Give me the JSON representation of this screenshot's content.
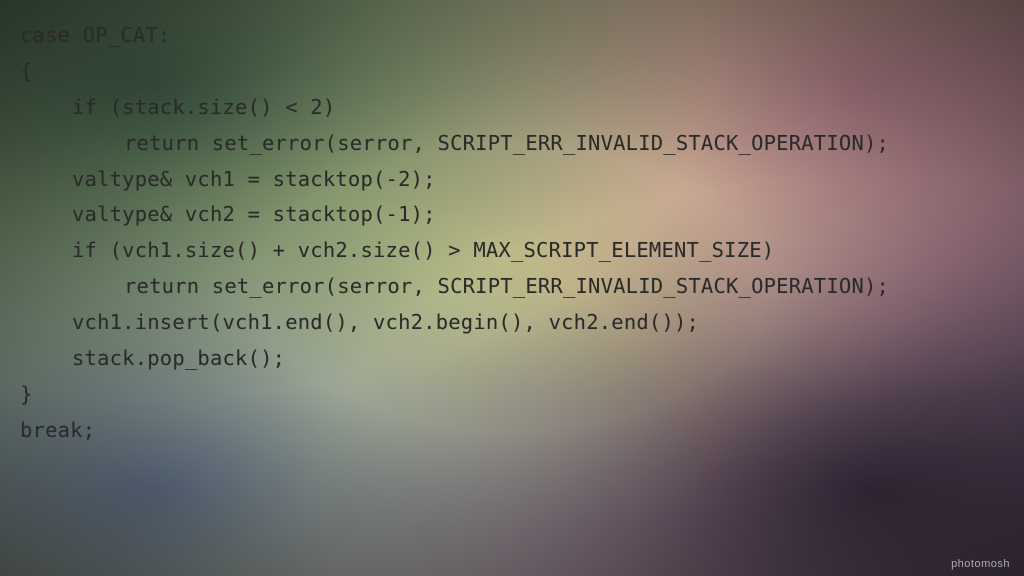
{
  "code": {
    "lines": [
      {
        "text": "case OP_CAT:",
        "indent": 0
      },
      {
        "text": "{",
        "indent": 0
      },
      {
        "text": "if (stack.size() < 2)",
        "indent": 1
      },
      {
        "text": "return set_error(serror, SCRIPT_ERR_INVALID_STACK_OPERATION);",
        "indent": 2
      },
      {
        "text": "valtype& vch1 = stacktop(-2);",
        "indent": 1
      },
      {
        "text": "valtype& vch2 = stacktop(-1);",
        "indent": 1
      },
      {
        "text": "if (vch1.size() + vch2.size() > MAX_SCRIPT_ELEMENT_SIZE)",
        "indent": 1
      },
      {
        "text": "return set_error(serror, SCRIPT_ERR_INVALID_STACK_OPERATION);",
        "indent": 2
      },
      {
        "text": "vch1.insert(vch1.end(), vch2.begin(), vch2.end());",
        "indent": 1
      },
      {
        "text": "stack.pop_back();",
        "indent": 1
      },
      {
        "text": "}",
        "indent": 0
      },
      {
        "text": "break;",
        "indent": 0
      }
    ]
  },
  "watermark": "photomosh"
}
